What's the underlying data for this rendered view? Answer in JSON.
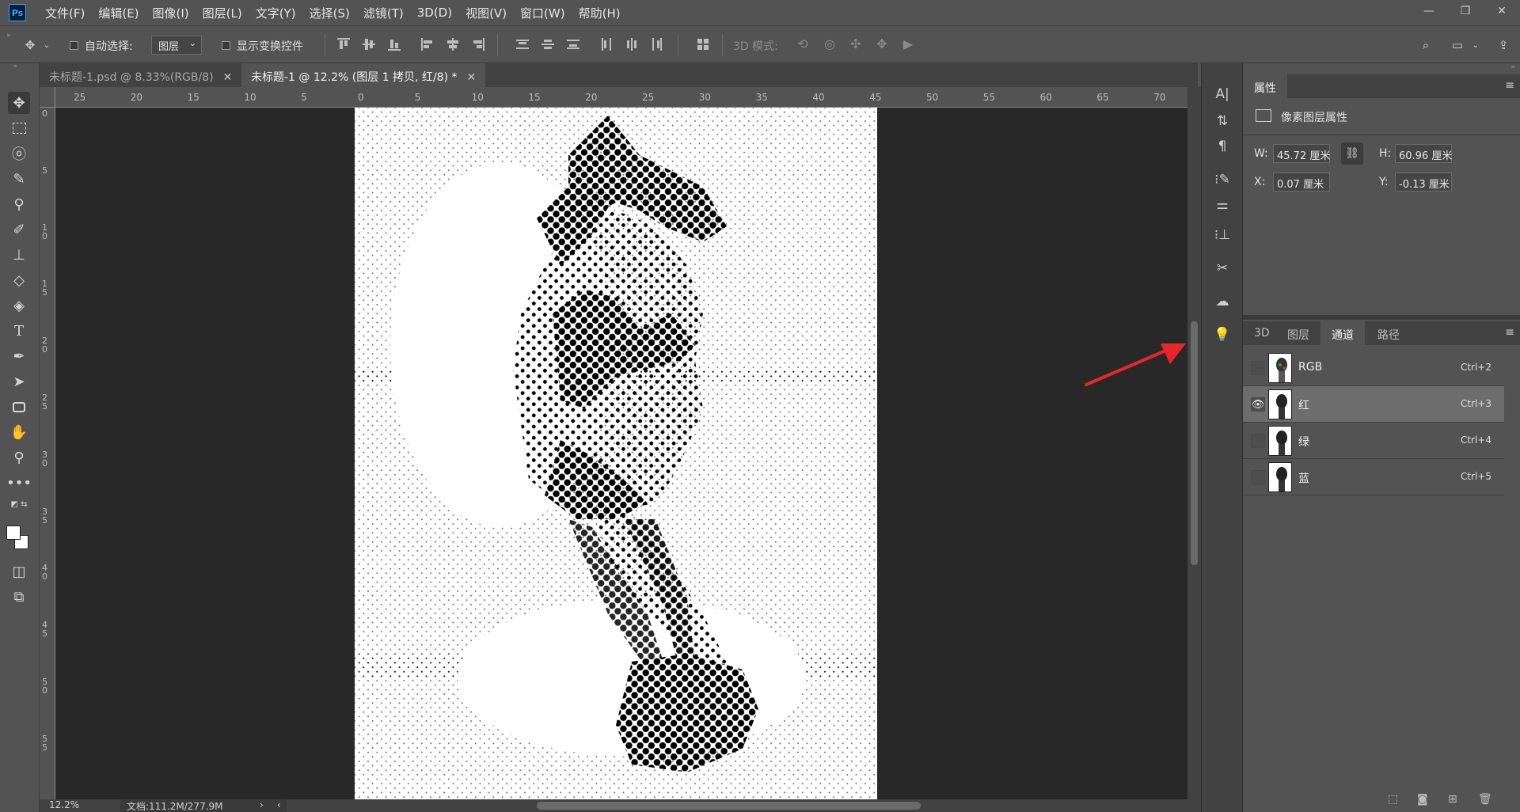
{
  "app": {
    "logo": "Ps"
  },
  "menu": [
    "文件(F)",
    "编辑(E)",
    "图像(I)",
    "图层(L)",
    "文字(Y)",
    "选择(S)",
    "滤镜(T)",
    "3D(D)",
    "视图(V)",
    "窗口(W)",
    "帮助(H)"
  ],
  "options": {
    "auto_select_label": "自动选择:",
    "auto_select_value": "图层",
    "show_transform_label": "显示变换控件",
    "mode3d_label": "3D 模式:"
  },
  "tabs": [
    {
      "title": "未标题-1.psd @ 8.33%(RGB/8)",
      "active": false
    },
    {
      "title": "未标题-1 @ 12.2% (图层 1 拷贝, 红/8) *",
      "active": true
    }
  ],
  "ruler_top": [
    "25",
    "20",
    "15",
    "10",
    "5",
    "0",
    "5",
    "10",
    "15",
    "20",
    "25",
    "30",
    "35",
    "40",
    "45",
    "50",
    "55",
    "60",
    "65",
    "70"
  ],
  "ruler_left": [
    "0",
    "5",
    "10",
    "15",
    "20",
    "25",
    "30",
    "35",
    "40",
    "45",
    "50",
    "55"
  ],
  "status": {
    "zoom": "12.2%",
    "doc": "文档:111.2M/277.9M"
  },
  "properties": {
    "tab": "属性",
    "type": "像素图层属性",
    "w_label": "W:",
    "w": "45.72 厘米",
    "h_label": "H:",
    "h": "60.96 厘米",
    "x_label": "X:",
    "x": "0.07 厘米",
    "y_label": "Y:",
    "y": "-0.13 厘米"
  },
  "panel_tabs": [
    {
      "label": "3D",
      "active": false
    },
    {
      "label": "图层",
      "active": false
    },
    {
      "label": "通道",
      "active": true
    },
    {
      "label": "路径",
      "active": false
    }
  ],
  "channels": [
    {
      "name": "RGB",
      "shortcut": "Ctrl+2",
      "visible": false,
      "selected": false
    },
    {
      "name": "红",
      "shortcut": "Ctrl+3",
      "visible": true,
      "selected": true
    },
    {
      "name": "绿",
      "shortcut": "Ctrl+4",
      "visible": false,
      "selected": false
    },
    {
      "name": "蓝",
      "shortcut": "Ctrl+5",
      "visible": false,
      "selected": false
    }
  ],
  "annotation": {
    "color": "#e8262a"
  }
}
